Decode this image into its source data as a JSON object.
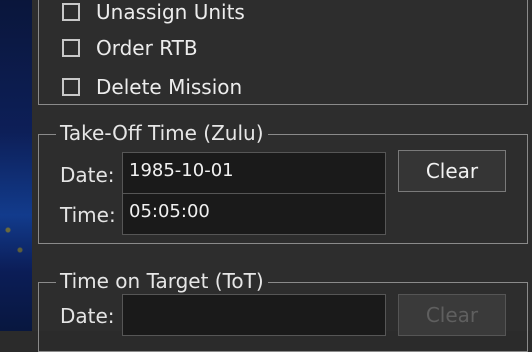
{
  "checkboxes": [
    {
      "label": "Unassign Units",
      "checked": false
    },
    {
      "label": "Order RTB",
      "checked": false
    },
    {
      "label": "Delete Mission",
      "checked": false
    }
  ],
  "takeoff": {
    "title": "Take-Off Time (Zulu)",
    "date_label": "Date:",
    "date_value": "1985-10-01",
    "time_label": "Time:",
    "time_value": "05:05:00",
    "clear_label": "Clear"
  },
  "tot": {
    "title": "Time on Target (ToT)",
    "date_label": "Date:",
    "date_value": "",
    "clear_label": "Clear"
  }
}
